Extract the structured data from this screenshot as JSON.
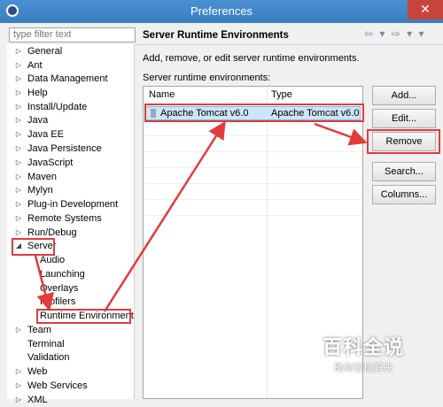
{
  "window": {
    "title": "Preferences",
    "close_glyph": "✕"
  },
  "filter": {
    "placeholder": "type filter text"
  },
  "tree": {
    "items": [
      {
        "label": "General"
      },
      {
        "label": "Ant"
      },
      {
        "label": "Data Management"
      },
      {
        "label": "Help"
      },
      {
        "label": "Install/Update"
      },
      {
        "label": "Java"
      },
      {
        "label": "Java EE"
      },
      {
        "label": "Java Persistence"
      },
      {
        "label": "JavaScript"
      },
      {
        "label": "Maven"
      },
      {
        "label": "Mylyn"
      },
      {
        "label": "Plug-in Development"
      },
      {
        "label": "Remote Systems"
      },
      {
        "label": "Run/Debug"
      },
      {
        "label": "Server"
      }
    ],
    "server_children": [
      {
        "label": "Audio"
      },
      {
        "label": "Launching"
      },
      {
        "label": "Overlays"
      },
      {
        "label": "Profilers"
      },
      {
        "label": "Runtime Environment"
      }
    ],
    "after": [
      {
        "label": "Team"
      },
      {
        "label": "Terminal"
      },
      {
        "label": "Validation"
      },
      {
        "label": "Web"
      },
      {
        "label": "Web Services"
      },
      {
        "label": "XML"
      }
    ]
  },
  "panel": {
    "title": "Server Runtime Environments",
    "nav_glyphs": "⇦ ▾ ⇨ ▾ ▾",
    "description": "Add, remove, or edit server runtime environments.",
    "env_label": "Server runtime environments:"
  },
  "table": {
    "columns": [
      "Name",
      "Type"
    ],
    "rows": [
      {
        "name": "Apache Tomcat v6.0",
        "type": "Apache Tomcat v6.0"
      }
    ]
  },
  "buttons": {
    "add": "Add...",
    "edit": "Edit...",
    "remove": "Remove",
    "search": "Search...",
    "columns": "Columns..."
  },
  "watermark": {
    "main": "百科全说",
    "sub": "助你轻松解决"
  },
  "colors": {
    "annotation": "#e23b3b",
    "titlebar": "#3a7fc1",
    "selection": "#cde6f7"
  }
}
